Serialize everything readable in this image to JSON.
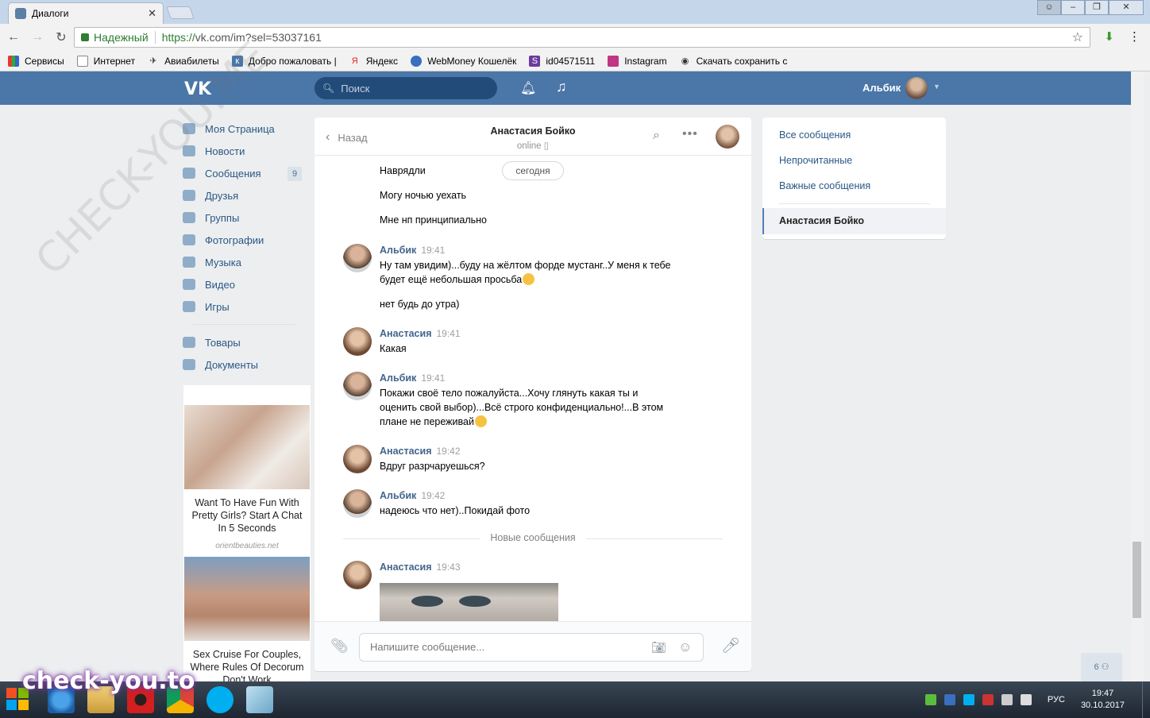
{
  "browser": {
    "tab_title": "Диалоги",
    "tab_close": "✕",
    "secure_label": "Надежный",
    "url_proto": "https://",
    "url_rest": "vk.com/im?sel=53037161",
    "bookmarks": [
      "Сервисы",
      "Интернет",
      "Авиабилеты",
      "Добро пожаловать |",
      "Яндекс",
      "WebMoney Кошелёк",
      "id04571511",
      "Instagram",
      "Скачать сохранить с"
    ]
  },
  "vk_header": {
    "logo": "VK",
    "search_placeholder": "Поиск",
    "user_name": "Альбик"
  },
  "left_menu": {
    "items": [
      "Моя Страница",
      "Новости",
      "Сообщения",
      "Друзья",
      "Группы",
      "Фотографии",
      "Музыка",
      "Видео",
      "Игры"
    ],
    "items2": [
      "Товары",
      "Документы"
    ],
    "messages_badge": "9"
  },
  "ads": {
    "ad1_text": "Want To Have Fun With Pretty Girls? Start A Chat In 5 Seconds",
    "ad1_source": "orientbeauties.net",
    "ad2_text": "Sex Cruise For Couples, Where Rules Of Decorum Don't Work"
  },
  "chat": {
    "back_label": "Назад",
    "peer_name": "Анастасия Бойко",
    "peer_status": "online",
    "today_label": "сегодня",
    "messages": [
      {
        "text": "Наврядли"
      },
      {
        "text": "Могу ночью уехать"
      },
      {
        "text": "Мне нп принципиально"
      },
      {
        "author": "Альбик",
        "time": "19:41",
        "line1": "Ну там увидим)...буду на жёлтом форде мустанг..У меня к тебе",
        "line2": "будет ещё небольшая просьба"
      },
      {
        "text": "нет будь до утра)"
      },
      {
        "author": "Анастасия",
        "time": "19:41",
        "text": "Какая"
      },
      {
        "author": "Альбик",
        "time": "19:41",
        "line1": "Покажи своё тело пожалуйста...Хочу глянуть какая ты и",
        "line2": "оценить свой выбор)...Всё строго конфиденциально!...В этом",
        "line3": "плане не переживай"
      },
      {
        "author": "Анастасия",
        "time": "19:42",
        "text": "Вдруг разрчаруешься?"
      },
      {
        "author": "Альбик",
        "time": "19:42",
        "text": "надеюсь что нет)..Покидай фото"
      },
      {
        "author": "Анастасия",
        "time": "19:43"
      }
    ],
    "new_messages_label": "Новые сообщения",
    "composer_placeholder": "Напишите сообщение..."
  },
  "right_panel": {
    "items": [
      "Все сообщения",
      "Непрочитанные",
      "Важные сообщения"
    ],
    "active": "Анастасия Бойко"
  },
  "friends_chip": "6 ⚇",
  "watermarks": {
    "diagonal": "CHECK-YOU.ME",
    "site": "check-you.to"
  },
  "taskbar": {
    "lang": "РУС",
    "time": "19:47",
    "date": "30.10.2017"
  }
}
